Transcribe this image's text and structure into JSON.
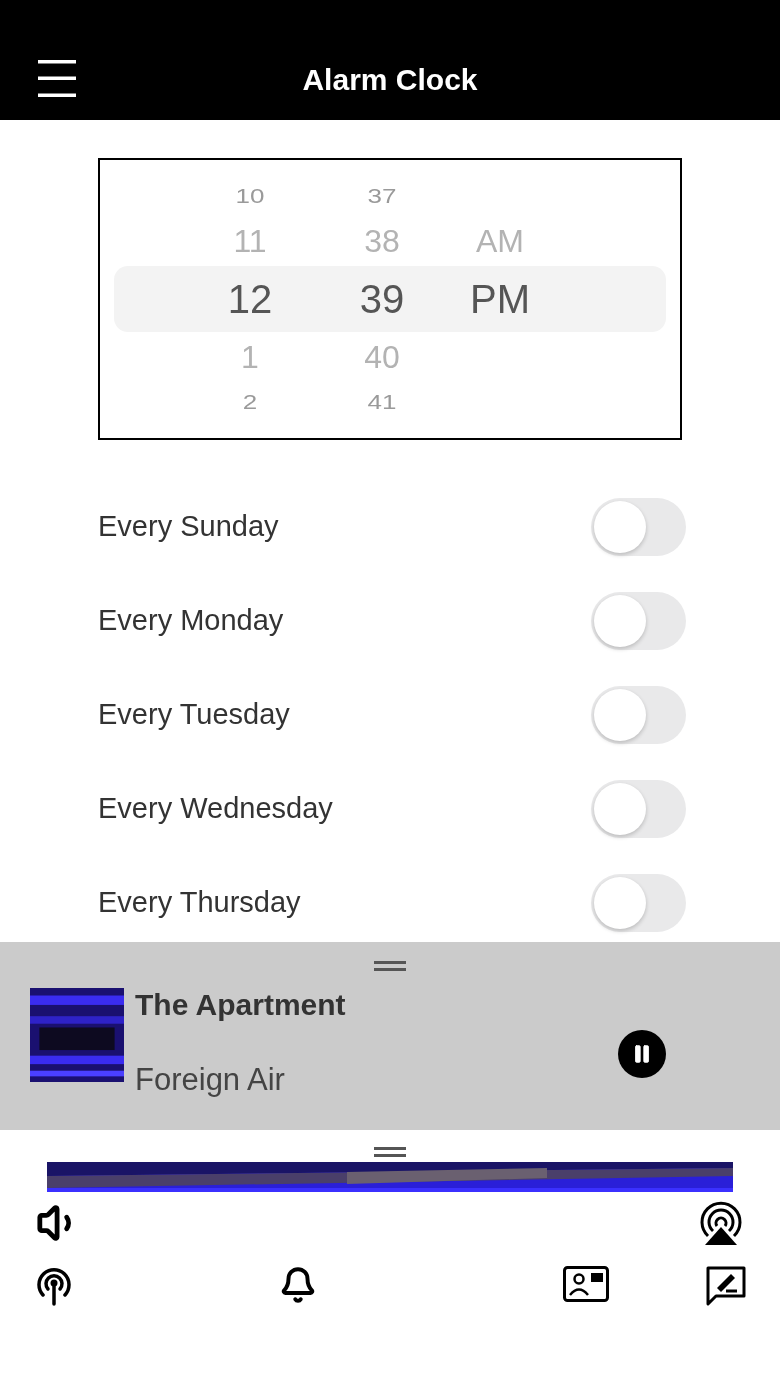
{
  "header": {
    "title": "Alarm Clock"
  },
  "picker": {
    "columns": [
      {
        "items": [
          {
            "label": "10",
            "selected": false
          },
          {
            "label": "11",
            "selected": false
          },
          {
            "label": "12",
            "selected": true
          },
          {
            "label": "1",
            "selected": false
          },
          {
            "label": "2",
            "selected": false
          }
        ]
      },
      {
        "items": [
          {
            "label": "37",
            "selected": false
          },
          {
            "label": "38",
            "selected": false
          },
          {
            "label": "39",
            "selected": true
          },
          {
            "label": "40",
            "selected": false
          },
          {
            "label": "41",
            "selected": false
          }
        ]
      },
      {
        "items": [
          {
            "label": "AM",
            "selected": false
          },
          {
            "label": "PM",
            "selected": true
          }
        ]
      }
    ]
  },
  "repeat_days": [
    {
      "label": "Every Sunday",
      "on": false
    },
    {
      "label": "Every Monday",
      "on": false
    },
    {
      "label": "Every Tuesday",
      "on": false
    },
    {
      "label": "Every Wednesday",
      "on": false
    },
    {
      "label": "Every Thursday",
      "on": false
    }
  ],
  "now_playing": {
    "title": "The Apartment",
    "artist": "Foreign Air",
    "playing": true
  }
}
